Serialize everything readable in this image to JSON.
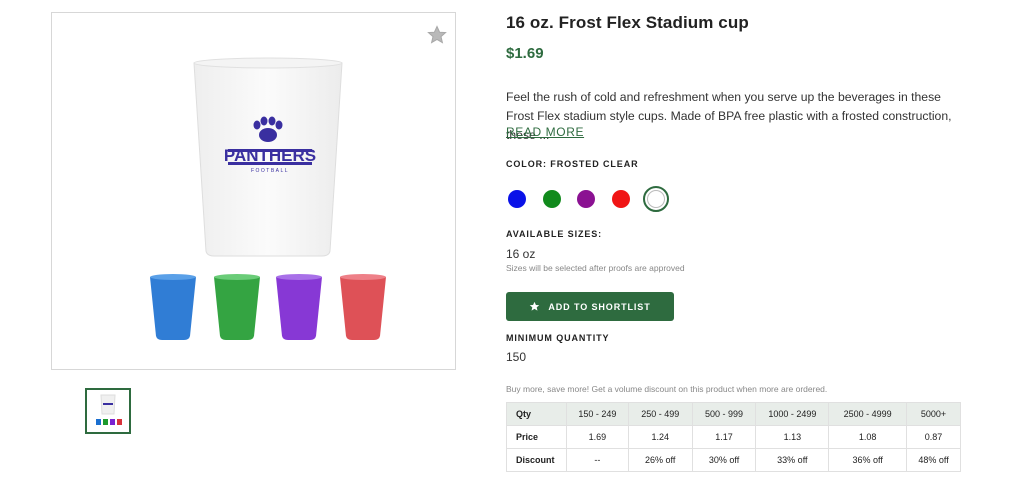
{
  "product": {
    "title": "16 oz. Frost Flex Stadium cup",
    "price": "$1.69",
    "description": "Feel the rush of cold and refreshment when you serve up the beverages in these Frost Flex stadium style cups. Made of BPA free plastic with a frosted construction, these ...",
    "read_more": "READ MORE"
  },
  "gallery": {
    "cup_logo_text": "PANTHERS",
    "cup_logo_sub": "FOOTBALL"
  },
  "colors": {
    "label": "COLOR: FROSTED CLEAR",
    "swatches": [
      {
        "name": "blue",
        "hex": "#0a12e8"
      },
      {
        "name": "green",
        "hex": "#118a1c"
      },
      {
        "name": "purple",
        "hex": "#8b1192"
      },
      {
        "name": "red",
        "hex": "#f01515"
      },
      {
        "name": "frosted-clear",
        "hex": "#ffffff"
      }
    ]
  },
  "sizes": {
    "label": "AVAILABLE SIZES:",
    "value": "16 oz",
    "note": "Sizes will be selected after proofs are approved"
  },
  "shortlist": {
    "label": "ADD TO SHORTLIST"
  },
  "min_quantity": {
    "label": "MINIMUM QUANTITY",
    "value": "150"
  },
  "pricing": {
    "note": "Buy more, save more! Get a volume discount on this product when more are ordered.",
    "header": [
      "Qty",
      "150 - 249",
      "250 - 499",
      "500 - 999",
      "1000 - 2499",
      "2500 - 4999",
      "5000+"
    ],
    "rows": [
      [
        "Price",
        "1.69",
        "1.24",
        "1.17",
        "1.13",
        "1.08",
        "0.87"
      ],
      [
        "Discount",
        "--",
        "26% off",
        "30% off",
        "33% off",
        "36% off",
        "48% off"
      ]
    ]
  },
  "theme": {
    "accent": "#2e6b3f"
  }
}
